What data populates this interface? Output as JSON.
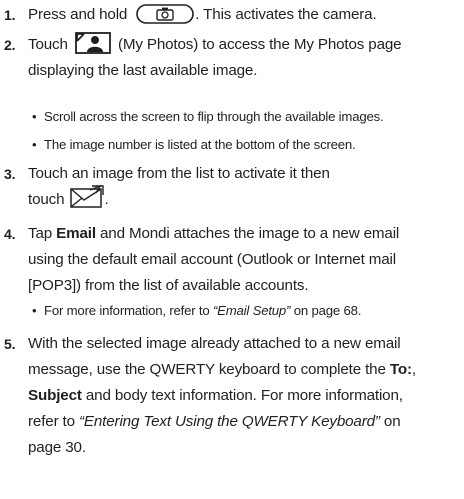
{
  "steps": [
    {
      "num": "1.",
      "text_before": "Press and hold",
      "text_after": ". This activates the camera.",
      "icon": "camera-key-icon"
    },
    {
      "num": "2.",
      "line1_before": "Touch",
      "line1_after": "(My Photos) to access the My Photos page",
      "line2": "displaying the last available image.",
      "icon": "my-photos-icon",
      "bullets": [
        "Scroll across the screen to flip through the available images.",
        "The image number is listed at the bottom of the screen."
      ]
    },
    {
      "num": "3.",
      "line1": "Touch an image from the list to activate it then",
      "line2_before": "touch",
      "line2_after": ".",
      "icon": "send-email-icon"
    },
    {
      "num": "4.",
      "line1_before": "Tap",
      "line1_bold": "Email",
      "line1_after": "and Mondi attaches the image to a new email",
      "line2": "using the default email account (Outlook or Internet mail",
      "line3": "[POP3]) from the list of available accounts.",
      "bullet_before": "For more information, refer to",
      "bullet_italic": "“Email Setup”",
      "bullet_after": " on page 68."
    },
    {
      "num": "5.",
      "line1": "With the selected image already attached to a new email",
      "line2_before": "message, use the QWERTY keyboard to complete the",
      "line2_bold": "To:",
      "line2_after": ",",
      "line3_bold": "Subject",
      "line3_after": "and body text information. For more information,",
      "line4_before": "refer to",
      "line4_italic": "“Entering Text Using the QWERTY Keyboard”",
      "line4_after": " on",
      "line5": "page 30."
    }
  ]
}
